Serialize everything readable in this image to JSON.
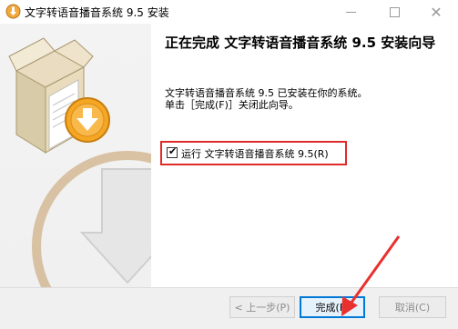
{
  "window": {
    "title": "文字转语音播音系统 9.5 安装",
    "min_icon": "minimize-icon",
    "max_icon": "maximize-icon",
    "close_icon": "close-icon",
    "app_icon": "installer-app-icon"
  },
  "banner": {
    "image": "installer-box-with-download-arrow-illustration"
  },
  "content": {
    "heading": "正在完成 文字转语音播音系统 9.5 安装向导",
    "info_line1": "文字转语音播音系统 9.5 已安装在你的系统。",
    "info_line2": "单击［完成(F)］关闭此向导。",
    "run_checkbox": {
      "label": "运行 文字转语音播音系统 9.5(R)",
      "checked": true
    }
  },
  "footer": {
    "back_label": "< 上一步(P)",
    "finish_label": "完成(F)",
    "cancel_label": "取消(C)"
  },
  "colors": {
    "highlight_box": "#e02a2a",
    "annotation_arrow": "#e8312f",
    "finish_border": "#0078d7",
    "banner_orange": "#f5a623"
  }
}
